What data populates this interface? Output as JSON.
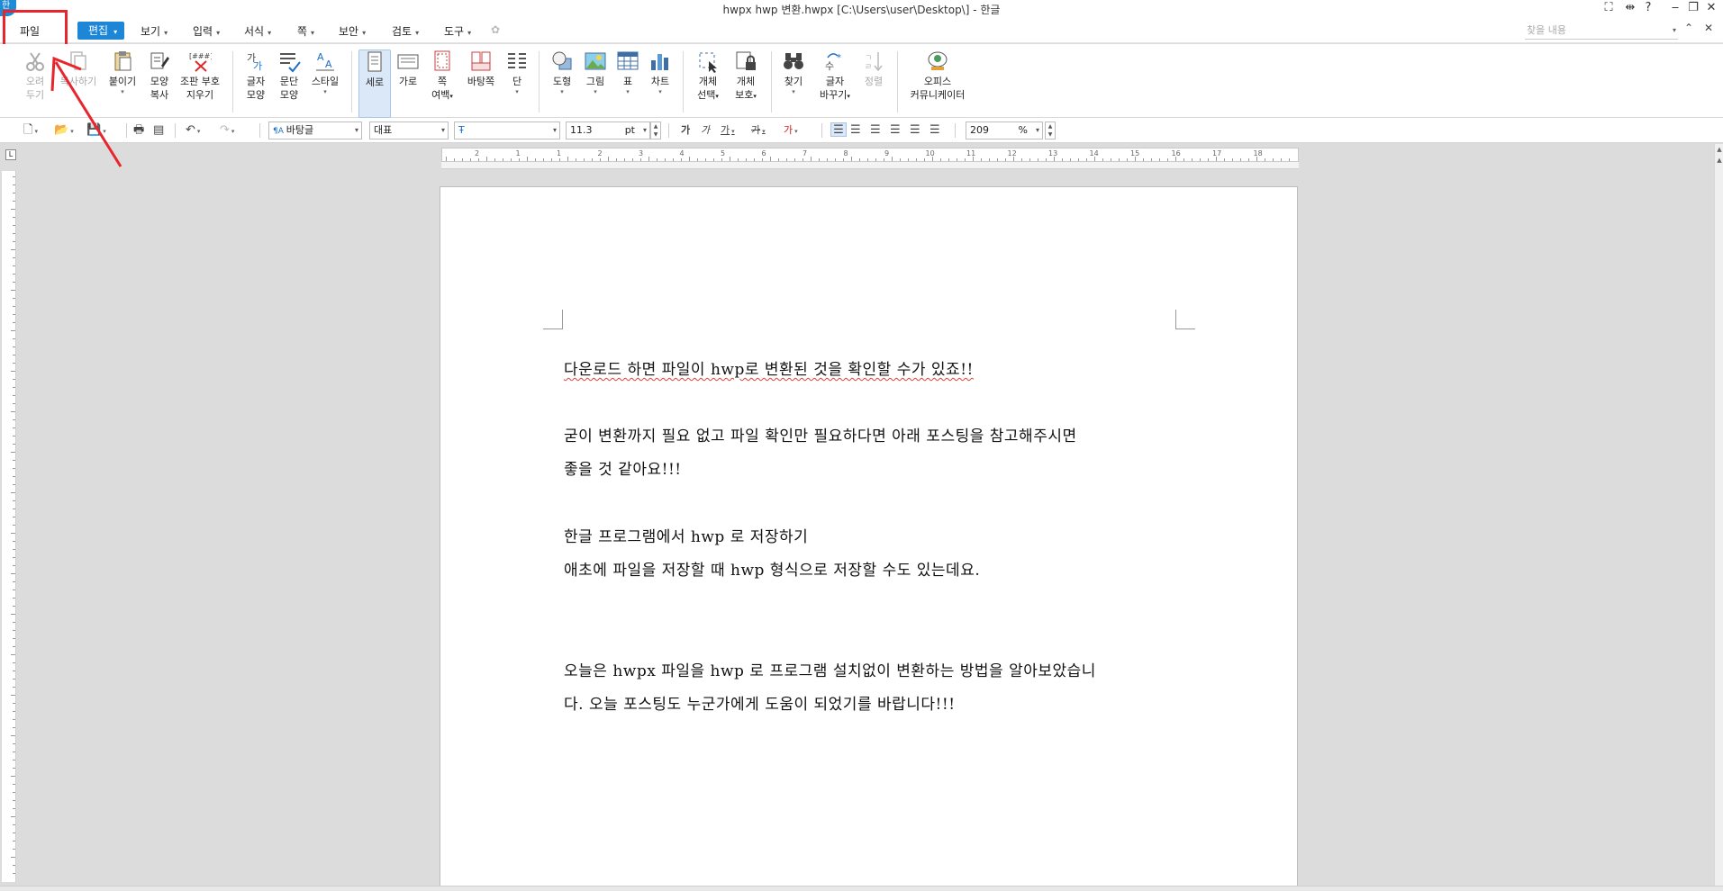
{
  "window": {
    "title": "hwpx hwp 변환.hwpx [C:\\Users\\user\\Desktop\\] - 한글",
    "logo": "한"
  },
  "menu": {
    "file": "파일",
    "edit": "편집",
    "items": [
      "보기",
      "입력",
      "서식",
      "쪽",
      "보안",
      "검토",
      "도구"
    ],
    "search_placeholder": "찾을 내용"
  },
  "ribbon": {
    "cut": [
      "오려",
      "두기"
    ],
    "copy": [
      "복사하기"
    ],
    "paste": [
      "붙이기"
    ],
    "format_copy": [
      "모양",
      "복사"
    ],
    "clear_marks": [
      "조판 부호",
      "지우기"
    ],
    "char_shape": [
      "글자",
      "모양"
    ],
    "para_shape": [
      "문단",
      "모양"
    ],
    "style": [
      "스타일"
    ],
    "portrait": [
      "세로"
    ],
    "landscape": [
      "가로"
    ],
    "margin": [
      "쪽",
      "여백"
    ],
    "background": [
      "바탕쪽"
    ],
    "columns": [
      "단"
    ],
    "shape": [
      "도형"
    ],
    "picture": [
      "그림"
    ],
    "table": [
      "표"
    ],
    "chart": [
      "차트"
    ],
    "select_obj": [
      "개체",
      "선택"
    ],
    "protect_obj": [
      "개체",
      "보호"
    ],
    "find": [
      "찾기"
    ],
    "replace": [
      "글자",
      "바꾸기"
    ],
    "sort": [
      "정렬"
    ],
    "office_comm": [
      "오피스",
      "커뮤니케이터"
    ]
  },
  "format": {
    "style": "바탕글",
    "font_lang": "대표",
    "font": "",
    "size": "11.3",
    "size_unit": "pt",
    "zoom": "209",
    "zoom_unit": "%"
  },
  "document": {
    "paragraphs": [
      "다운로드 하면 파일이 hwp로 변환된 것을 확인할 수가 있죠!!",
      "굳이 변환까지 필요 없고 파일 확인만 필요하다면 아래 포스팅을 참고해주시면",
      "좋을 것 같아요!!!",
      "한글 프로그램에서 hwp 로 저장하기",
      "애초에 파일을 저장할 때 hwp 형식으로 저장할 수도 있는데요.",
      "오늘은 hwpx 파일을 hwp 로 프로그램 설치없이 변환하는 방법을 알아보았습니",
      "다. 오늘 포스팅도 누군가에게 도움이 되었기를 바랍니다!!!"
    ]
  },
  "ruler": {
    "h_ticks": [
      "2",
      "1",
      "1",
      "2",
      "3",
      "4",
      "5",
      "6",
      "7",
      "8",
      "9",
      "10",
      "11",
      "12",
      "13",
      "14",
      "15",
      "16",
      "17",
      "18"
    ]
  },
  "colors": {
    "accent": "#1d86d6",
    "highlight": "#e8242c"
  }
}
